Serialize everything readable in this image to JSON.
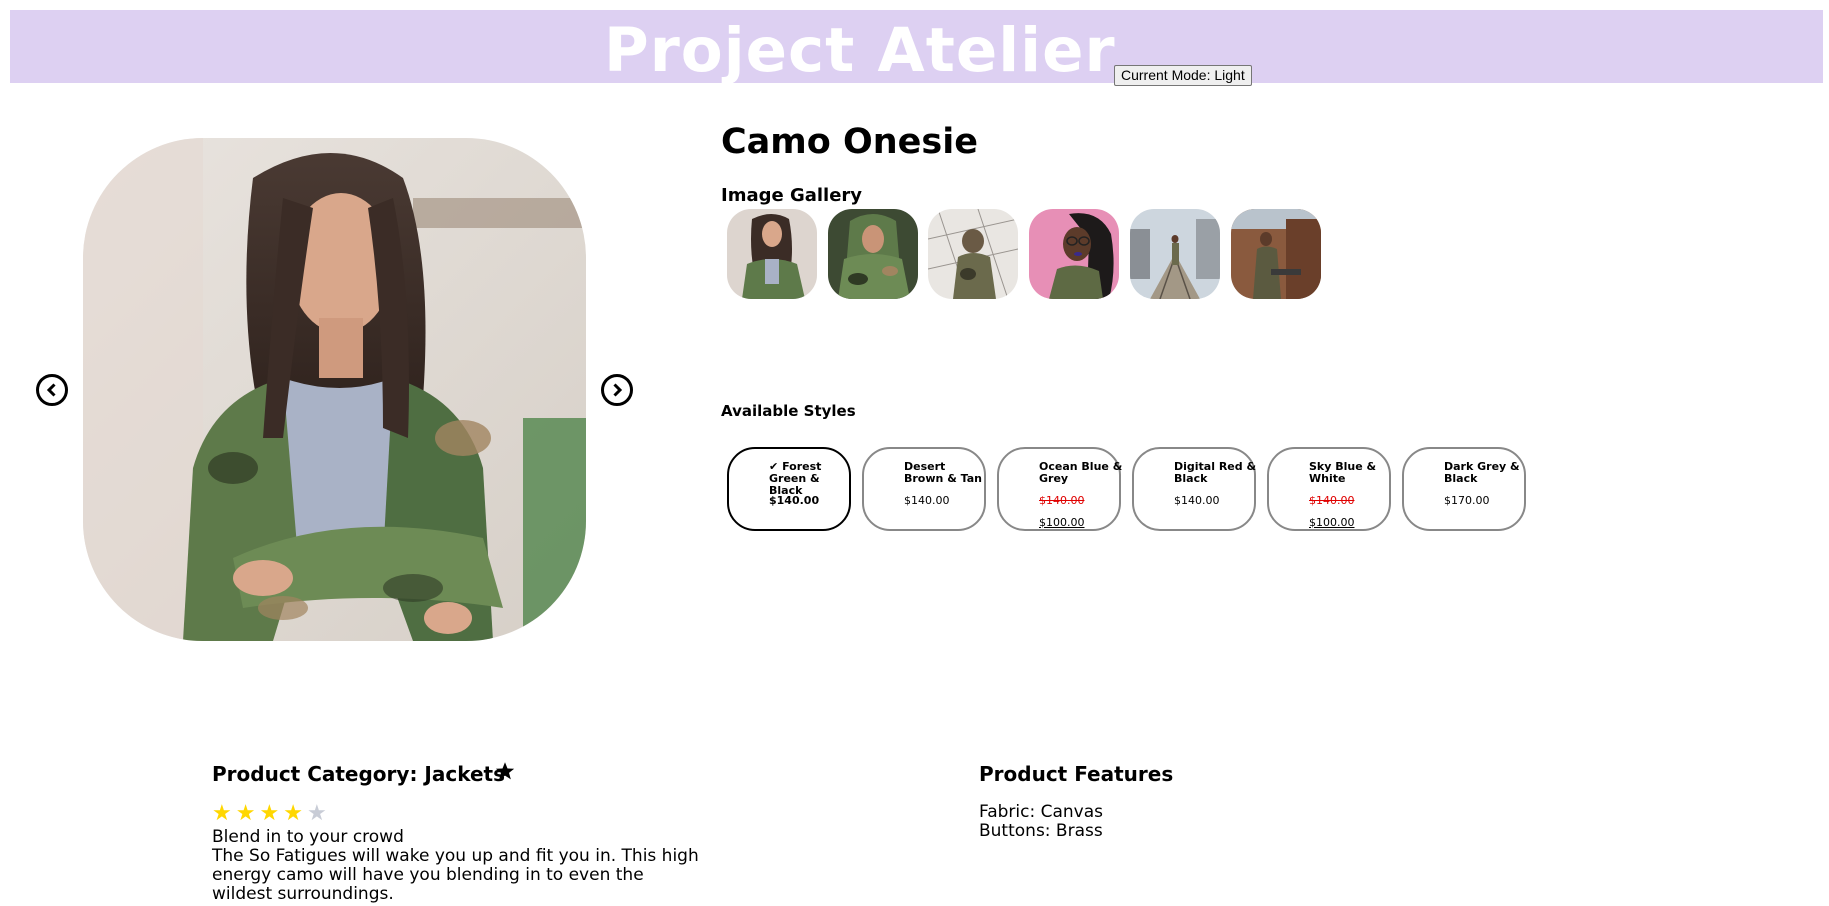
{
  "header": {
    "title": "Project Atelier",
    "mode_button_label": "Current Mode: Light",
    "bg_color": "#ddd0f2"
  },
  "carousel": {
    "prev_icon": "chevron-left-circle-icon",
    "next_icon": "chevron-right-circle-icon"
  },
  "product": {
    "name": "Camo Onesie",
    "category_label": "Product Category: Jackets",
    "favorite_icon": "star-icon",
    "rating": 4,
    "rating_max": 5,
    "slogan": "Blend in to your crowd",
    "description": "The So Fatigues will wake you up and fit you in. This high energy camo will have you blending in to even the wildest surroundings."
  },
  "gallery": {
    "heading": "Image Gallery",
    "thumbnails": [
      "thumbnail-woman-camo-jacket",
      "thumbnail-woman-camo-hoodie",
      "thumbnail-camo-figure-fence",
      "thumbnail-woman-pink-backdrop",
      "thumbnail-person-rail-tracks",
      "thumbnail-person-brick-wall"
    ]
  },
  "styles": {
    "heading": "Available Styles",
    "items": [
      {
        "name": "Forest Green & Black",
        "price": "$140.00",
        "sale": "",
        "selected": true
      },
      {
        "name": "Desert Brown & Tan",
        "price": "$140.00",
        "sale": "",
        "selected": false
      },
      {
        "name": "Ocean Blue & Grey",
        "price": "$140.00",
        "sale": "$100.00",
        "selected": false
      },
      {
        "name": "Digital Red & Black",
        "price": "$140.00",
        "sale": "",
        "selected": false
      },
      {
        "name": "Sky Blue & White",
        "price": "$140.00",
        "sale": "$100.00",
        "selected": false
      },
      {
        "name": "Dark Grey & Black",
        "price": "$170.00",
        "sale": "",
        "selected": false
      }
    ],
    "selected_mark": "✔"
  },
  "features": {
    "heading": "Product Features",
    "items": [
      "Fabric: Canvas",
      "Buttons: Brass"
    ]
  },
  "colors": {
    "star_filled": "#ffd700",
    "star_empty": "#c8ccd6",
    "sale_old_price": "#e00000"
  }
}
